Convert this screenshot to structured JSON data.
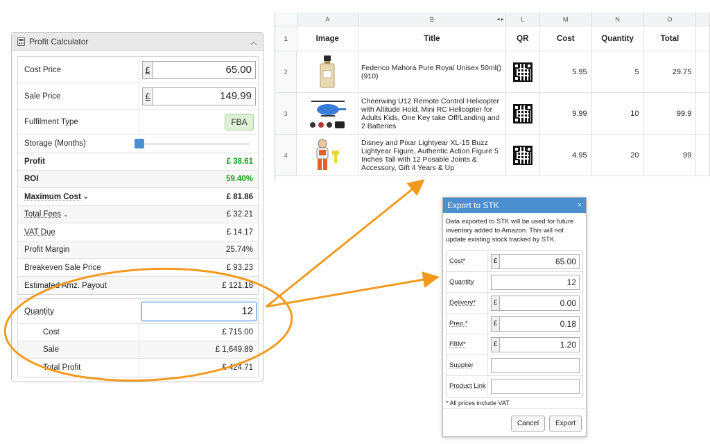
{
  "calculator": {
    "title": "Profit Calculator",
    "cost_price_label": "Cost Price",
    "cost_price_value": "65.00",
    "sale_price_label": "Sale Price",
    "sale_price_value": "149.99",
    "currency_symbol": "£",
    "fulfilment_label": "Fulfilment Type",
    "fulfilment_value": "FBA",
    "storage_label": "Storage (Months)",
    "storage_months": 0,
    "profit_label": "Profit",
    "profit_value": "£ 38.61",
    "roi_label": "ROI",
    "roi_value": "59.40%",
    "max_cost_label": "Maximum Cost",
    "max_cost_value": "£ 81.86",
    "total_fees_label": "Total Fees",
    "total_fees_value": "£ 32.21",
    "vat_label": "VAT Due",
    "vat_value": "£ 14.17",
    "margin_label": "Profit Margin",
    "margin_value": "25.74%",
    "breakeven_label": "Breakeven Sale Price",
    "breakeven_value": "£ 93.23",
    "payout_label": "Estimated Amz. Payout",
    "payout_value": "£ 121.18",
    "quantity_label": "Quantity",
    "quantity_value": "12",
    "cost_label": "Cost",
    "cost_value": "£ 715.00",
    "sale_label": "Sale",
    "sale_value": "£ 1,649.89",
    "total_profit_label": "Total Profit",
    "total_profit_value": "£ 424.71"
  },
  "sheet": {
    "col_letters": [
      "A",
      "B",
      "L",
      "M",
      "N",
      "O"
    ],
    "col_nav": "◂ ▸",
    "headers": {
      "image": "Image",
      "title": "Title",
      "qr": "QR",
      "cost": "Cost",
      "quantity": "Quantity",
      "total": "Total"
    },
    "rows": [
      {
        "num": "1"
      },
      {
        "num": "2",
        "title": "Federico Mahora Pure Royal Unisex 50ml() (910)",
        "cost": "5.95",
        "quantity": "5",
        "total": "29.75"
      },
      {
        "num": "3",
        "title": "Cheerwing U12 Remote Control Helicopter with Altitude Hold, Mini RC Helicopter for Adults Kids, One Key take Off/Landing and 2 Batteries",
        "cost": "9.99",
        "quantity": "10",
        "total": "99.9"
      },
      {
        "num": "4",
        "title": "Disney and Pixar Lightyear XL-15 Buzz Lightyear Figure, Authentic Action Figure 5 Inches Tall with 12 Posable Joints & Accessory, Gift 4 Years & Up",
        "cost": "4.95",
        "quantity": "20",
        "total": "99"
      }
    ]
  },
  "dialog": {
    "title": "Export to STK",
    "close": "×",
    "description": "Data exported to STK will be used for future inventory added to Amazon. This will not update existing stock tracked by STK.",
    "currency_symbol": "£",
    "fields": {
      "cost_label": "Cost*",
      "cost_value": "65.00",
      "quantity_label": "Quantity",
      "quantity_value": "12",
      "delivery_label": "Delivery*",
      "delivery_value": "0.00",
      "prep_label": "Prep.*",
      "prep_value": "0.18",
      "fbm_label": "FBM*",
      "fbm_value": "1.20",
      "supplier_label": "Supplier",
      "supplier_value": "",
      "product_link_label": "Product Link",
      "product_link_value": ""
    },
    "note": "* All prices include VAT",
    "cancel_label": "Cancel",
    "export_label": "Export"
  },
  "colors": {
    "accent": "#4a8fd0",
    "highlight": "#f39a1e",
    "profit_green": "#1a9a1a"
  }
}
